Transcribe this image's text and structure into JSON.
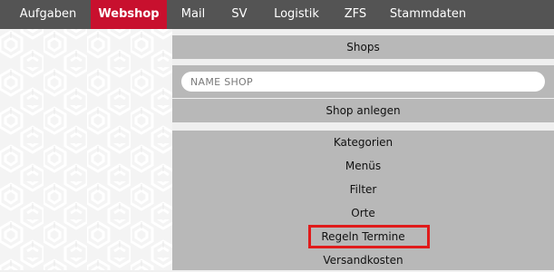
{
  "nav": {
    "items": [
      {
        "label": "Aufgaben",
        "active": false
      },
      {
        "label": "Webshop",
        "active": true
      },
      {
        "label": "Mail",
        "active": false
      },
      {
        "label": "SV",
        "active": false
      },
      {
        "label": "Logistik",
        "active": false
      },
      {
        "label": "ZFS",
        "active": false
      },
      {
        "label": "Stammdaten",
        "active": false
      }
    ]
  },
  "shops": {
    "header": "Shops",
    "search_placeholder": "NAME SHOP",
    "create_button": "Shop anlegen"
  },
  "menu": {
    "items": [
      "Kategorien",
      "Menüs",
      "Filter",
      "Orte",
      "Regeln Termine",
      "Versandkosten"
    ]
  },
  "colors": {
    "nav_bg": "#545454",
    "nav_active": "#c8102e",
    "panel_bar": "#b8b8b8",
    "highlight_border": "#e01b1b"
  }
}
